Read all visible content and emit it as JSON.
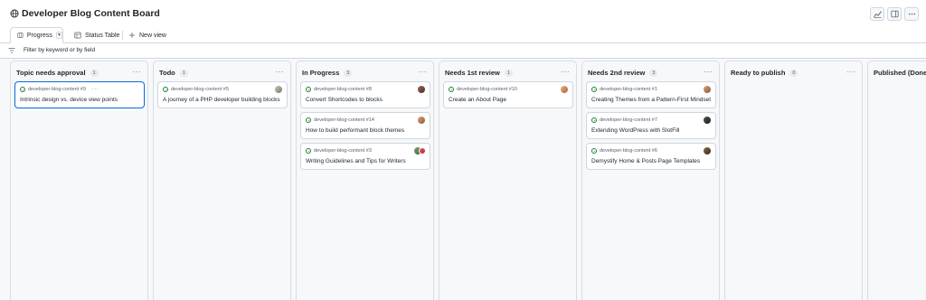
{
  "app": {
    "title": "Developer Blog Content Board"
  },
  "tabs": [
    {
      "label": "Progress",
      "icon": "board-icon",
      "active": true
    },
    {
      "label": "Status Table",
      "icon": "table-icon",
      "active": false
    },
    {
      "label": "New view",
      "icon": "plus-icon",
      "active": false
    }
  ],
  "filter": {
    "placeholder": "Filter by keyword or by field"
  },
  "columns": [
    {
      "title": "Topic needs approval",
      "count": "1",
      "cards": [
        {
          "repo": "developer-blog-content #9",
          "title": "Intrinsic design vs. device view points",
          "selected": true
        }
      ]
    },
    {
      "title": "Todo",
      "count": "1",
      "cards": [
        {
          "repo": "developer-blog-content #5",
          "title": "A journey of a PHP developer building blocks"
        }
      ]
    },
    {
      "title": "In Progress",
      "count": "3",
      "cards": [
        {
          "repo": "developer-blog-content #8",
          "title": "Convert Shortcodes to blocks"
        },
        {
          "repo": "developer-blog-content #14",
          "title": "How to build performant block themes"
        },
        {
          "repo": "developer-blog-content #3",
          "title": "Writing Guidelines and Tips for Writers"
        }
      ]
    },
    {
      "title": "Needs 1st review",
      "count": "1",
      "cards": [
        {
          "repo": "developer-blog-content #10",
          "title": "Create an About Page"
        }
      ]
    },
    {
      "title": "Needs 2nd review",
      "count": "3",
      "cards": [
        {
          "repo": "developer-blog-content #1",
          "title": "Creating Themes from a Pattern-First Mindset"
        },
        {
          "repo": "developer-blog-content #7",
          "title": "Extending WordPress with SlotFill"
        },
        {
          "repo": "developer-blog-content #6",
          "title": "Demystify Home & Posts Page Templates"
        }
      ]
    },
    {
      "title": "Ready to publish",
      "count": "0",
      "cards": []
    },
    {
      "title": "Published (Done)",
      "count": "",
      "cards": []
    }
  ],
  "colors": {
    "accent": "#0969da",
    "open_status": "#1a7f37",
    "border": "#d0d7de",
    "board_bg": "#f6f8fa"
  }
}
